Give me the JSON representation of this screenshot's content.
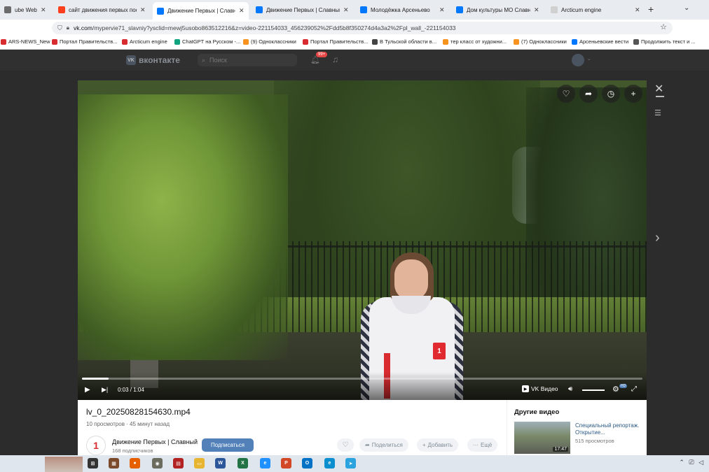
{
  "browser": {
    "tabs": [
      {
        "label": "ube Webmail :: Вх",
        "icon_color": "#6b6b6b"
      },
      {
        "label": "сайт движения первых посел",
        "icon_color": "#fc3f1d"
      },
      {
        "label": "Движение Первых | Славный",
        "icon_color": "#0077ff",
        "active": true
      },
      {
        "label": "Движение Первых | Славный",
        "icon_color": "#0077ff"
      },
      {
        "label": "Молодёжка Арсеньево",
        "icon_color": "#0077ff"
      },
      {
        "label": "Дом культуры МО Славный",
        "icon_color": "#0077ff"
      },
      {
        "label": "Arcticum engine",
        "icon_color": "#d0d0d0"
      }
    ],
    "url_host": "vk.com",
    "url_path": "/mypervie71_slavniy?ysclid=mewj5usobo863512216&z=video-221154033_456239052%2Fdd5b8f350274d4a3a2%2Fpl_wall_-221154033",
    "bookmarks": [
      {
        "label": "ARS-NEWS_New",
        "color": "#d92c30"
      },
      {
        "label": "Портал Правительств...",
        "color": "#d92c30"
      },
      {
        "label": "Arcticum engine",
        "color": "#d92c30"
      },
      {
        "label": "ChatGPT на Русском -...",
        "color": "#10a37f"
      },
      {
        "label": "(9) Одноклассники",
        "color": "#f7931e"
      },
      {
        "label": "Портал Правительств...",
        "color": "#d92c30"
      },
      {
        "label": "В Тульской области в...",
        "color": "#444444"
      },
      {
        "label": "тер класс от художни...",
        "color": "#f7931e"
      },
      {
        "label": "(7) Одноклассники",
        "color": "#f7931e"
      },
      {
        "label": "Арсеньевские вести",
        "color": "#0077ff"
      },
      {
        "label": "Продолжить текст и ...",
        "color": "#555555"
      }
    ]
  },
  "vk": {
    "logo_text": "вконтакте",
    "search_placeholder": "Поиск",
    "notification_count": "99+"
  },
  "player": {
    "current_time": "0:03",
    "duration": "1:04",
    "progress_fraction": 0.047,
    "brand": "VK Видео",
    "hd_badge": "HD"
  },
  "video": {
    "title": "lv_0_20250828154630.mp4",
    "views": "10 просмотров",
    "posted": "45 минут назад",
    "channel_name": "Движение Первых | Славный",
    "channel_subs": "168 подписчиков",
    "subscribe_label": "Подписаться",
    "share_label": "Поделиться",
    "add_label": "Добавить",
    "more_label": "Ещё"
  },
  "other_videos": {
    "title": "Другие видео",
    "items": [
      {
        "name": "Специальный репортаж. Открытие...",
        "views": "515 просмотров",
        "duration": "17:47"
      }
    ]
  },
  "taskbar": {
    "apps": [
      {
        "icon": "task-view-icon",
        "color": "#333333",
        "glyph": "⊞"
      },
      {
        "icon": "photos-icon",
        "color": "#7a4a2a",
        "glyph": "▦"
      },
      {
        "icon": "firefox-icon",
        "color": "#e66000",
        "glyph": "●"
      },
      {
        "icon": "gimp-icon",
        "color": "#6b6b5e",
        "glyph": "◉"
      },
      {
        "icon": "winrar-icon",
        "color": "#b22222",
        "glyph": "▤"
      },
      {
        "icon": "explorer-icon",
        "color": "#e8b531",
        "glyph": "▭"
      },
      {
        "icon": "word-icon",
        "color": "#2b579a",
        "glyph": "W"
      },
      {
        "icon": "excel-icon",
        "color": "#217346",
        "glyph": "X"
      },
      {
        "icon": "ie-icon",
        "color": "#1e90ff",
        "glyph": "e"
      },
      {
        "icon": "powerpoint-icon",
        "color": "#d24726",
        "glyph": "P"
      },
      {
        "icon": "outlook-icon",
        "color": "#0072c6",
        "glyph": "O"
      },
      {
        "icon": "edge-icon",
        "color": "#0c8fcf",
        "glyph": "e"
      },
      {
        "icon": "telegram-icon",
        "color": "#2aa3df",
        "glyph": "➤"
      }
    ]
  }
}
